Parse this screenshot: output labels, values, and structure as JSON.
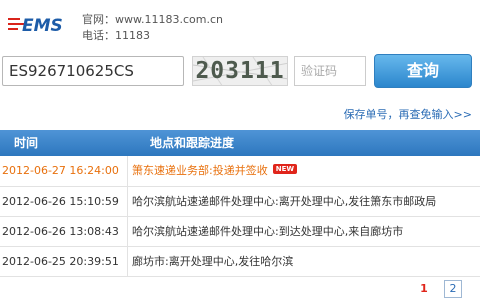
{
  "header": {
    "logo_text": "EMS",
    "website": "官网：www.11183.com.cn",
    "phone": "电话：11183"
  },
  "search": {
    "tracking_number": "ES926710625CS",
    "captcha_text": "203111",
    "verify_placeholder": "验证码",
    "query_label": "查询",
    "save_link": "保存单号，再查免输入>>"
  },
  "table": {
    "headers": {
      "time": "时间",
      "detail": "地点和跟踪进度"
    },
    "new_badge": "NEW",
    "rows": [
      {
        "time": "2012-06-27 16:24:00",
        "detail": "箫东速递业务部:投递并签收",
        "latest": true
      },
      {
        "time": "2012-06-26 15:10:59",
        "detail": "哈尔滨航站速递邮件处理中心:离开处理中心,发往箫东市邮政局"
      },
      {
        "time": "2012-06-26 13:08:43",
        "detail": "哈尔滨航站速递邮件处理中心:到达处理中心,来自廊坊市"
      },
      {
        "time": "2012-06-25 20:39:51",
        "detail": "廊坊市:离开处理中心,发往哈尔滨"
      }
    ]
  },
  "pagination": {
    "current": "1",
    "next": "2"
  },
  "colors": {
    "brand_blue": "#1d5ca8",
    "brand_red": "#d9241b",
    "header_blue": "#3a84c9",
    "latest_orange": "#e8700d",
    "button_blue": "#2b86cd"
  },
  "icons": {
    "logo": "ems-logo-icon"
  }
}
